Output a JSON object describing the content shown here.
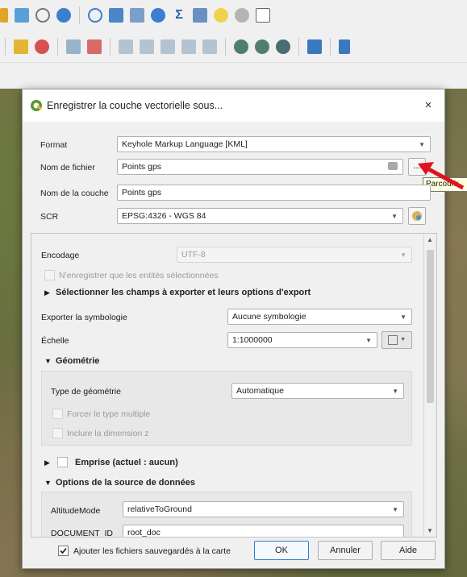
{
  "colors": {
    "accent": "#2d7fd2",
    "arrow": "#e0141e"
  },
  "dialog": {
    "title": "Enregistrer la couche vectorielle sous...",
    "close_label": "×",
    "format_label": "Format",
    "format_value": "Keyhole Markup Language [KML]",
    "filename_label": "Nom de fichier",
    "filename_value": "Points gps",
    "browse_label": "...",
    "browse_tooltip": "Parcourir",
    "layer_name_label": "Nom de la couche",
    "layer_name_value": "Points gps",
    "crs_label": "SCR",
    "crs_value": "EPSG:4326 - WGS 84",
    "encoding_label": "Encodage",
    "encoding_value": "UTF-8",
    "only_selected_label": "N'enregistrer que les entités sélectionnées",
    "fields_section": "Sélectionner les champs à exporter et leurs options d'export",
    "symbology_label": "Exporter la symbologie",
    "symbology_value": "Aucune symbologie",
    "scale_label": "Échelle",
    "scale_value": "1:1000000",
    "geometry_section": "Géométrie",
    "geometry_type_label": "Type de géométrie",
    "geometry_type_value": "Automatique",
    "force_multi_label": "Forcer le type multiple",
    "include_z_label": "Inclure la dimension z",
    "extent_label": "Emprise (actuel : aucun)",
    "datasource_section": "Options de la source de données",
    "altitude_mode_label": "AltitudeMode",
    "altitude_mode_value": "relativeToGround",
    "document_id_label": "DOCUMENT_ID",
    "document_id_value": "root_doc",
    "add_saved_label": "Ajouter les fichiers sauvegardés à la carte",
    "ok_label": "OK",
    "cancel_label": "Annuler",
    "help_label": "Aide"
  }
}
